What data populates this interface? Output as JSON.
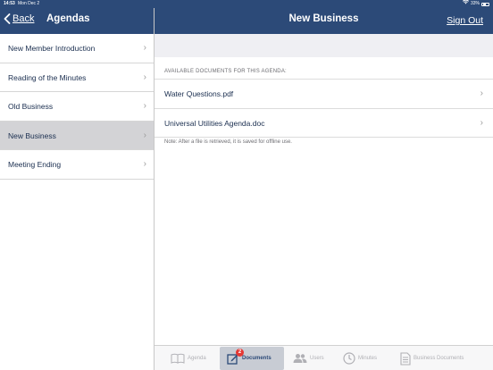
{
  "status_bar": {
    "time": "14:53",
    "date": "Mon Dec 2",
    "battery": "33%"
  },
  "left_header": {
    "back_label": "Back",
    "title": "Agendas"
  },
  "right_header": {
    "title": "New Business",
    "sign_out_label": "Sign Out"
  },
  "agendas": {
    "items": [
      {
        "label": "New Member Introduction",
        "selected": false
      },
      {
        "label": "Reading of the Minutes",
        "selected": false
      },
      {
        "label": "Old Business",
        "selected": false
      },
      {
        "label": "New Business",
        "selected": true
      },
      {
        "label": "Meeting Ending",
        "selected": false
      }
    ]
  },
  "documents": {
    "section_label": "AVAILABLE DOCUMENTS FOR THIS AGENDA:",
    "items": [
      {
        "label": "Water Questions.pdf"
      },
      {
        "label": "Universal Utilities Agenda.doc"
      }
    ],
    "note": "Note: After a file is retrieved, it is saved for offline use."
  },
  "tab_bar": {
    "tabs": [
      {
        "label": "Agenda",
        "icon": "book-icon",
        "active": false
      },
      {
        "label": "Documents",
        "icon": "edit-document-icon",
        "active": true,
        "badge": "2"
      },
      {
        "label": "Users",
        "icon": "users-icon",
        "active": false
      },
      {
        "label": "Minutes",
        "icon": "clock-icon",
        "active": false
      },
      {
        "label": "Business Documents",
        "icon": "document-icon",
        "active": false
      }
    ]
  },
  "colors": {
    "header_bg": "#2c4a78",
    "selected_row": "#d3d3d6",
    "badge": "#e53935"
  }
}
